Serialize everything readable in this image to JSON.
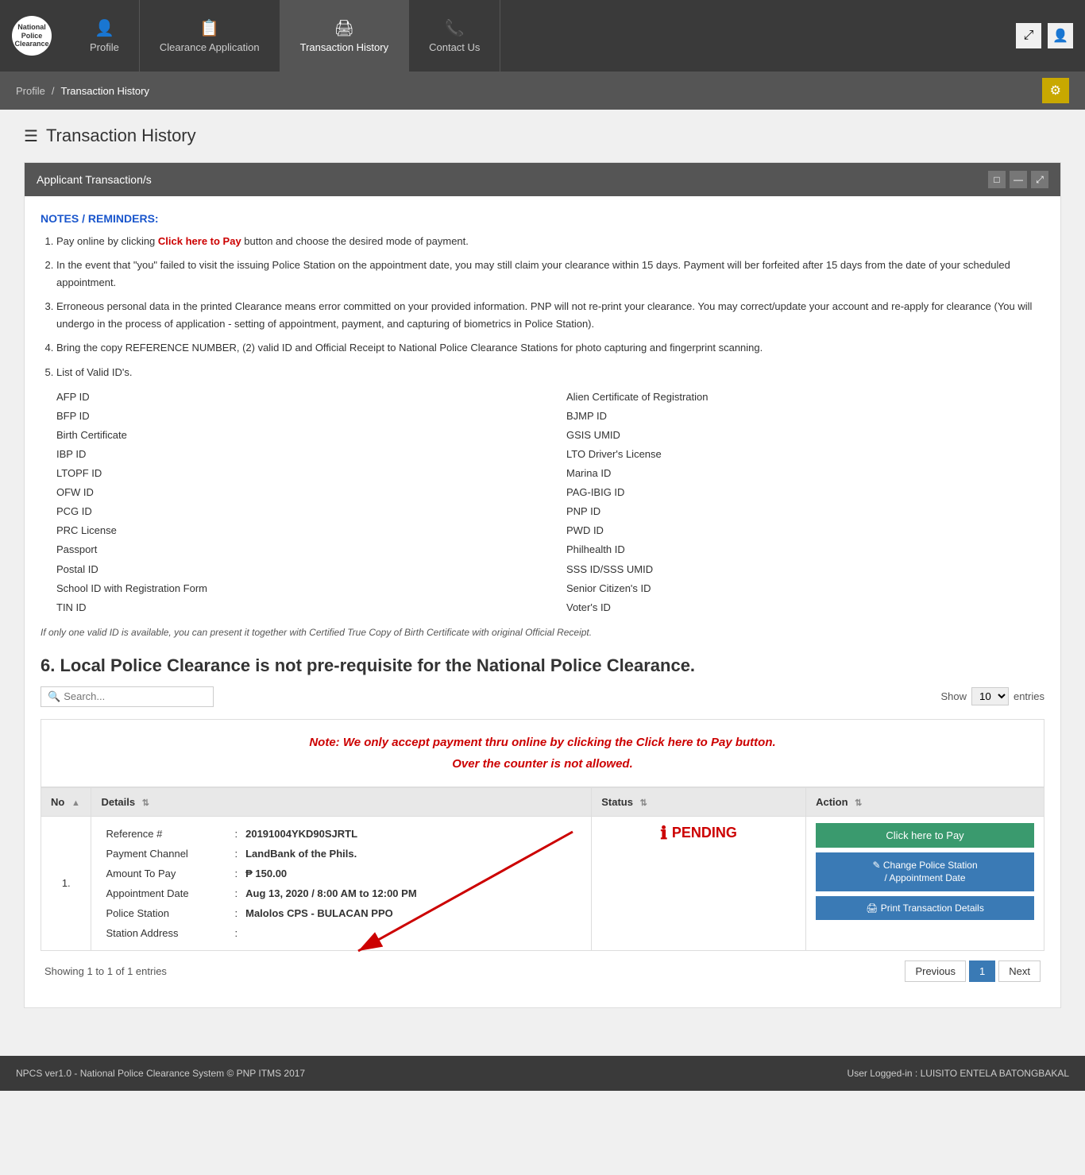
{
  "brand": {
    "line1": "National Police",
    "line2": "Clearance"
  },
  "nav": {
    "items": [
      {
        "id": "profile",
        "label": "Profile",
        "icon": "👤"
      },
      {
        "id": "clearance-application",
        "label": "Clearance Application",
        "icon": "📋"
      },
      {
        "id": "transaction-history",
        "label": "Transaction History",
        "icon": "🖨"
      },
      {
        "id": "contact-us",
        "label": "Contact Us",
        "icon": "📞"
      }
    ],
    "active": "transaction-history"
  },
  "topbar_buttons": {
    "resize": "⤢",
    "user": "👤"
  },
  "breadcrumb": {
    "items": [
      {
        "label": "Profile",
        "link": true
      },
      {
        "label": "Transaction History",
        "link": false
      }
    ]
  },
  "settings_icon": "⚙",
  "page_title": "Transaction History",
  "page_title_icon": "☰",
  "panel": {
    "title": "Applicant Transaction/s",
    "controls": [
      "□",
      "—",
      "⤢"
    ]
  },
  "notes": {
    "title": "NOTES / REMINDERS:",
    "items": [
      {
        "text_before": "Pay online by clicking ",
        "link_text": "Click here to Pay",
        "text_after": " button and choose the desired mode of payment."
      },
      {
        "text": "In the event that \"you\" failed to visit the issuing Police Station on the appointment date, you may still claim your clearance within 15 days. Payment will ber forfeited after 15 days from the date of your scheduled appointment."
      },
      {
        "text": "Erroneous personal data in the printed Clearance means error committed on your provided information. PNP will not re-print your clearance. You may correct/update your account and re-apply for clearance (You will undergo in the process of application - setting of appointment, payment, and capturing of biometrics in Police Station)."
      },
      {
        "text": "Bring the copy REFERENCE NUMBER, (2) valid ID and Official Receipt to National Police Clearance Stations for photo capturing and fingerprint scanning."
      },
      {
        "text": "List of Valid ID's."
      }
    ],
    "valid_ids_col1": [
      "AFP ID",
      "BFP ID",
      "Birth Certificate",
      "IBP ID",
      "LTOPF ID",
      "OFW ID",
      "PCG ID",
      "PRC License",
      "Passport",
      "Postal ID",
      "School ID with Registration Form",
      "TIN ID"
    ],
    "valid_ids_col2": [
      "Alien Certificate of Registration",
      "BJMP ID",
      "GSIS UMID",
      "LTO Driver's License",
      "Marina ID",
      "PAG-IBIG ID",
      "PNP ID",
      "PWD ID",
      "Philhealth ID",
      "SSS ID/SSS UMID",
      "Senior Citizen's ID",
      "Voter's ID"
    ],
    "italic_note": "If only one valid ID is available, you can present it together with Certified True Copy of Birth Certificate with original Official Receipt.",
    "local_clearance_note": "6. Local Police Clearance is not pre-requisite for the National Police Clearance."
  },
  "table_controls": {
    "search_placeholder": "Search...",
    "show_label": "Show",
    "entries_label": "entries",
    "show_value": "10"
  },
  "payment_note": "Note: We only accept payment thru online by clicking the Click here to Pay button.\nOver the counter is not allowed.",
  "table": {
    "headers": [
      {
        "label": "No",
        "sortable": true
      },
      {
        "label": "Details",
        "sortable": true
      },
      {
        "label": "Status",
        "sortable": true
      },
      {
        "label": "Action",
        "sortable": true
      }
    ],
    "rows": [
      {
        "no": "1.",
        "reference_label": "Reference #",
        "reference_value": "20191004YKD90SJRTL",
        "payment_channel_label": "Payment Channel",
        "payment_channel_value": "LandBank of the Phils.",
        "amount_label": "Amount To Pay",
        "amount_value": "₱ 150.00",
        "appointment_label": "Appointment Date",
        "appointment_value": "Aug 13, 2020 / 8:00 AM to 12:00 PM",
        "station_label": "Police Station",
        "station_value": "Malolos CPS - BULACAN PPO",
        "address_label": "Station Address",
        "address_value": "",
        "status": "PENDING",
        "status_icon": "ℹ",
        "action_pay": "Click here to Pay",
        "action_change": "Change Police Station / Appointment Date",
        "action_print": "Print Transaction Details"
      }
    ]
  },
  "table_footer": {
    "showing_text": "Showing 1 to 1 of 1 entries"
  },
  "pagination": {
    "previous": "Previous",
    "next": "Next",
    "pages": [
      "1"
    ]
  },
  "footer": {
    "left": "NPCS ver1.0 - National Police Clearance System © PNP ITMS 2017",
    "right": "User Logged-in : LUISITO ENTELA BATONGBAKAL"
  }
}
